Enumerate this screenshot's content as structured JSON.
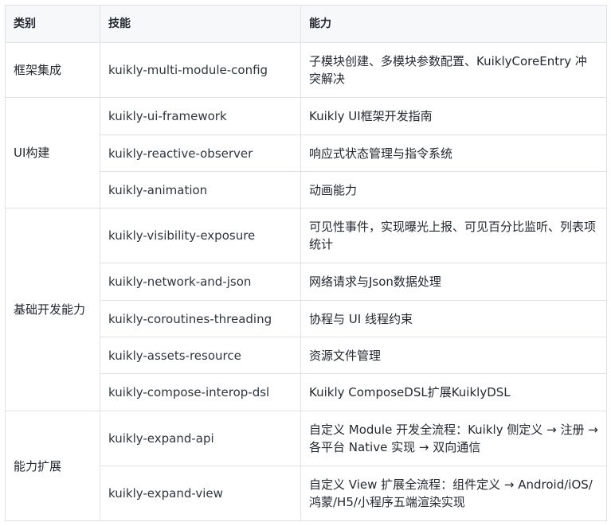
{
  "table": {
    "headers": {
      "category": "类别",
      "skill": "技能",
      "capability": "能力"
    },
    "groups": [
      {
        "category": "框架集成",
        "rows": [
          {
            "skill": "kuikly-multi-module-config",
            "capability": "子模块创建、多模块参数配置、KuiklyCoreEntry 冲突解决"
          }
        ]
      },
      {
        "category": "UI构建",
        "rows": [
          {
            "skill": "kuikly-ui-framework",
            "capability": "Kuikly UI框架开发指南"
          },
          {
            "skill": "kuikly-reactive-observer",
            "capability": "响应式状态管理与指令系统"
          },
          {
            "skill": "kuikly-animation",
            "capability": "动画能力"
          }
        ]
      },
      {
        "category": "基础开发能力",
        "rows": [
          {
            "skill": "kuikly-visibility-exposure",
            "capability": "可见性事件，实现曝光上报、可见百分比监听、列表项统计"
          },
          {
            "skill": "kuikly-network-and-json",
            "capability": "网络请求与Json数据处理"
          },
          {
            "skill": "kuikly-coroutines-threading",
            "capability": "协程与 UI 线程约束"
          },
          {
            "skill": "kuikly-assets-resource",
            "capability": "资源文件管理"
          },
          {
            "skill": "kuikly-compose-interop-dsl",
            "capability": "Kuikly ComposeDSL扩展KuiklyDSL"
          }
        ]
      },
      {
        "category": "能力扩展",
        "rows": [
          {
            "skill": "kuikly-expand-api",
            "capability": "自定义 Module 开发全流程：Kuikly 侧定义 → 注册 → 各平台 Native 实现 → 双向通信"
          },
          {
            "skill": "kuikly-expand-view",
            "capability": "自定义 View 扩展全流程：组件定义 → Android/iOS/鸿蒙/H5/小程序五端渲染实现"
          }
        ]
      }
    ]
  }
}
